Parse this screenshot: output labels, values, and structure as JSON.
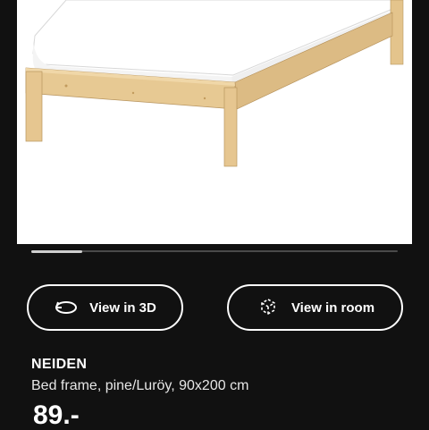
{
  "product": {
    "name": "NEIDEN",
    "description": "Bed frame, pine/Luröy, 90x200 cm",
    "price": "89.-"
  },
  "gallery": {
    "image_alt": "NEIDEN bed frame in pine with white mattress",
    "progress_fraction": 0.14
  },
  "actions": {
    "view_3d_label": "View in 3D",
    "view_room_label": "View in room"
  },
  "icons": {
    "view_3d": "rotate-3d-icon",
    "view_room": "ar-cube-icon"
  },
  "colors": {
    "background": "#111111",
    "text": "#ffffff",
    "wood": "#e3c48e",
    "mattress": "#ffffff"
  }
}
